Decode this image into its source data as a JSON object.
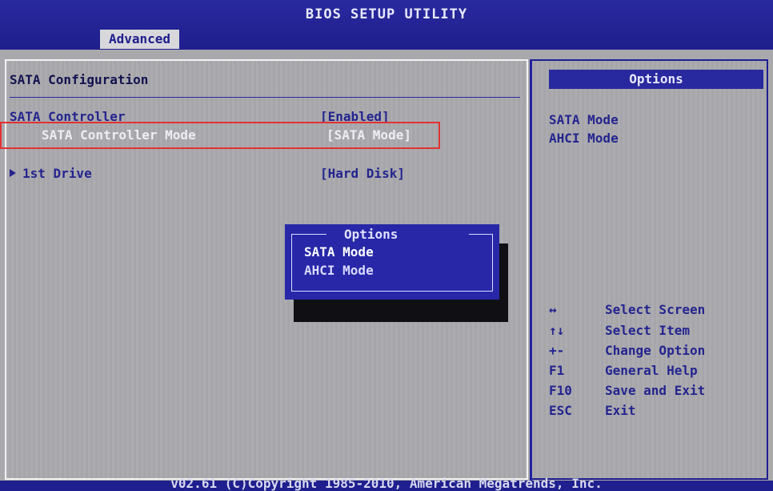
{
  "header": {
    "title": "BIOS SETUP UTILITY",
    "active_tab": "Advanced"
  },
  "main": {
    "section_title": "SATA Configuration",
    "rows": [
      {
        "label": "SATA Controller",
        "value": "[Enabled]"
      },
      {
        "label": "SATA Controller Mode",
        "value": "[SATA Mode]"
      },
      {
        "label": "1st Drive",
        "value": "[Hard Disk]"
      }
    ]
  },
  "popup": {
    "title": "Options",
    "options": [
      "SATA Mode",
      "AHCI Mode"
    ],
    "selected": "SATA Mode"
  },
  "side": {
    "options_header": "Options",
    "options": [
      "SATA Mode",
      "AHCI Mode"
    ],
    "help": [
      {
        "key": "↔",
        "text": "Select Screen"
      },
      {
        "key": "↑↓",
        "text": "Select Item"
      },
      {
        "key": "+-",
        "text": "Change Option"
      },
      {
        "key": "F1",
        "text": "General Help"
      },
      {
        "key": "F10",
        "text": "Save and Exit"
      },
      {
        "key": "ESC",
        "text": "Exit"
      }
    ]
  },
  "footer": {
    "copyright": "v02.61 (C)Copyright 1985-2010, American Megatrends, Inc."
  },
  "colors": {
    "bios_blue": "#1f1f8f",
    "panel_gray": "#a9a9ad",
    "highlight_red": "#e23232"
  }
}
